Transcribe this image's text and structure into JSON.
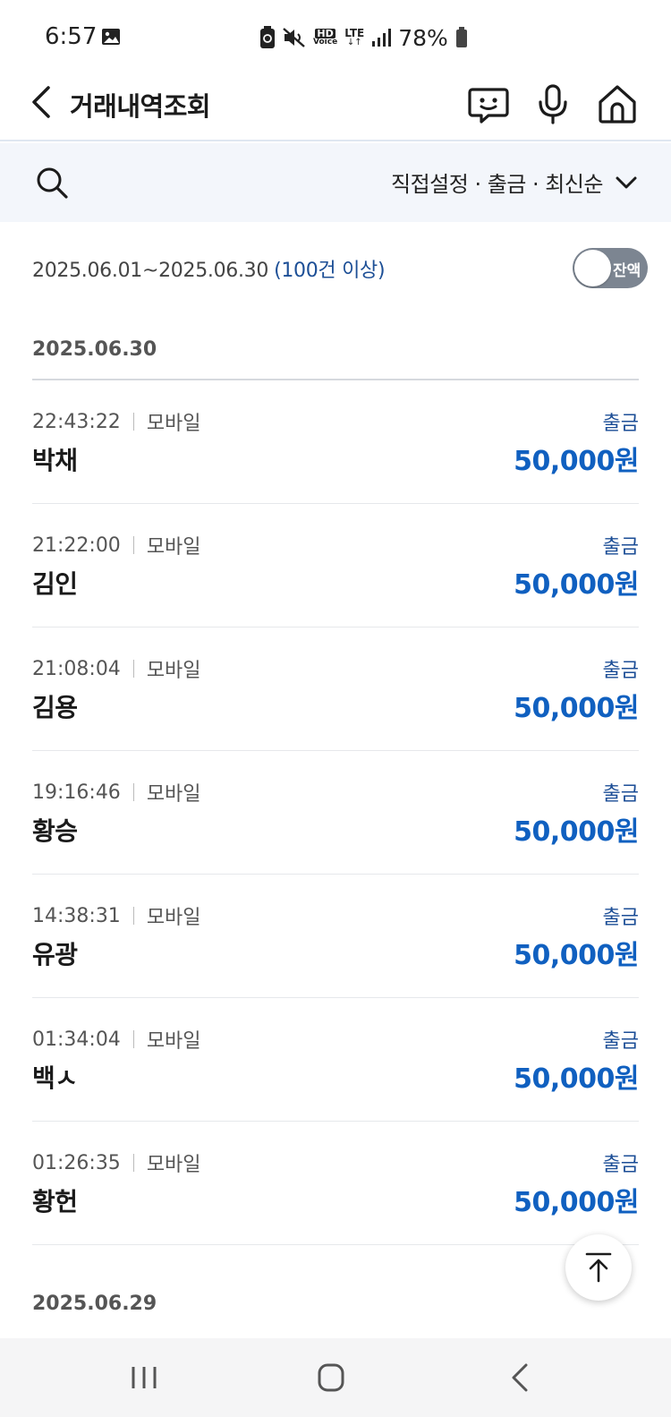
{
  "status_bar": {
    "time": "6:57",
    "battery": "78%",
    "hd_label": "HD",
    "voice_label": "Voice",
    "lte_label": "LTE"
  },
  "header": {
    "title": "거래내역조회",
    "icons": [
      "back-arrow-icon",
      "chat-bot-icon",
      "microphone-icon",
      "home-icon"
    ]
  },
  "filter": {
    "summary": "직접설정 · 출금 · 최신순"
  },
  "period": {
    "range": "2025.06.01~2025.06.30",
    "count": "(100건 이상)",
    "balance_toggle_label": "잔액"
  },
  "groups": [
    {
      "date": "2025.06.30",
      "items": [
        {
          "time": "22:43:22",
          "channel": "모바일",
          "name": "박채",
          "type": "출금",
          "amount": "50,000원"
        },
        {
          "time": "21:22:00",
          "channel": "모바일",
          "name": "김인",
          "type": "출금",
          "amount": "50,000원"
        },
        {
          "time": "21:08:04",
          "channel": "모바일",
          "name": "김용",
          "type": "출금",
          "amount": "50,000원"
        },
        {
          "time": "19:16:46",
          "channel": "모바일",
          "name": "황승",
          "type": "출금",
          "amount": "50,000원"
        },
        {
          "time": "14:38:31",
          "channel": "모바일",
          "name": "유광",
          "type": "출금",
          "amount": "50,000원"
        },
        {
          "time": "01:34:04",
          "channel": "모바일",
          "name": "백ㅅ",
          "type": "출금",
          "amount": "50,000원"
        },
        {
          "time": "01:26:35",
          "channel": "모바일",
          "name": "황헌",
          "type": "출금",
          "amount": "50,000원"
        }
      ]
    },
    {
      "date": "2025.06.29",
      "items": []
    }
  ],
  "colors": {
    "accent_blue": "#1060c0",
    "label_blue": "#1b4d96",
    "filter_bg": "#f3f6fb",
    "toggle_off": "#7c8591"
  }
}
